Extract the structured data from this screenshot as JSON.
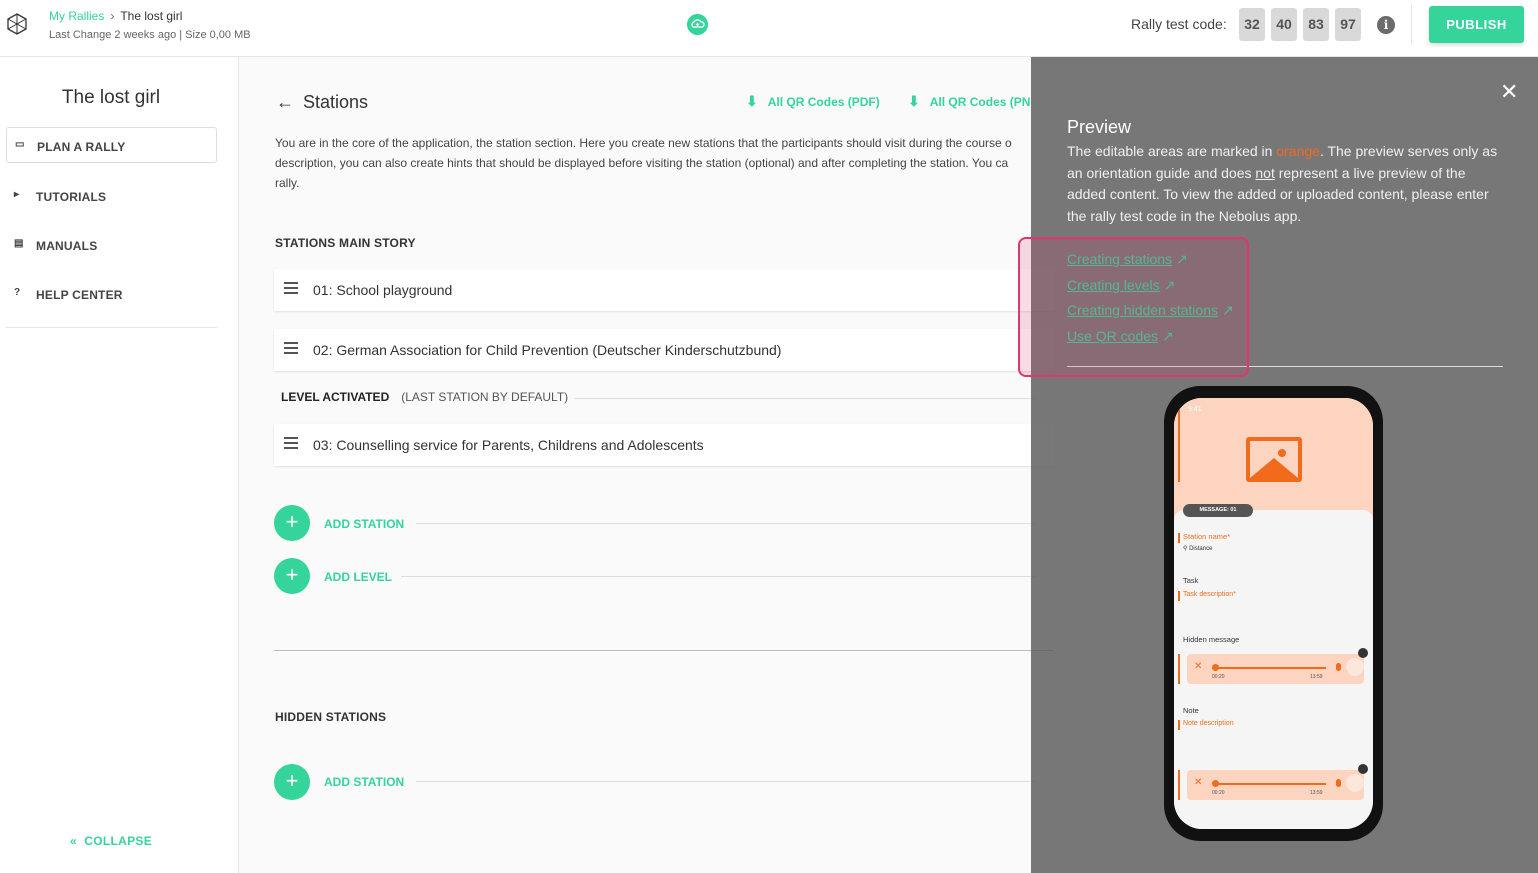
{
  "header": {
    "breadcrumb_parent": "My Rallies",
    "breadcrumb_current": "The lost girl",
    "meta": "Last Change 2 weeks ago | Size 0,00 MB",
    "rally_code_label": "Rally test code:",
    "rally_code": [
      "32",
      "40",
      "83",
      "97"
    ],
    "info_glyph": "i",
    "publish_label": "PUBLISH"
  },
  "sidebar": {
    "title": "The lost girl",
    "items": [
      {
        "label": "PLAN A RALLY",
        "icon": "ticket-icon"
      },
      {
        "label": "TUTORIALS",
        "icon": "play-icon"
      },
      {
        "label": "MANUALS",
        "icon": "document-icon"
      },
      {
        "label": "HELP CENTER",
        "icon": "question-icon"
      }
    ],
    "collapse_label": "COLLAPSE"
  },
  "main": {
    "title": "Stations",
    "download_pdf": "All QR Codes (PDF)",
    "download_png": "All QR Codes (PN",
    "intro_line1": "You are in the core of the application, the station section. Here you create new stations that the participants should visit during the course o",
    "intro_line2": "description, you can also create hints that should be displayed before visiting the station (optional) and after completing the station. You ca",
    "intro_line3": "rally.",
    "main_story_heading": "STATIONS MAIN STORY",
    "stations": [
      "01: School playground",
      "02: German Association for Child Prevention (Deutscher Kinderschutzbund)",
      "03: Counselling service for Parents, Childrens and Adolescents"
    ],
    "level_label": "LEVEL ACTIVATED",
    "level_note": "(LAST STATION BY DEFAULT)",
    "add_station": "ADD STATION",
    "add_level": "ADD LEVEL",
    "hidden_heading": "HIDDEN STATIONS",
    "add_hidden_station": "ADD STATION"
  },
  "preview": {
    "title": "Preview",
    "text_before_orange": "The editable areas are marked in ",
    "orange_word": "orange",
    "text_after_orange": ". The preview serves only as an orientation guide and does ",
    "not_word": "not",
    "text_end": " represent a live preview of the added content. To view the added or uploaded content, please enter the rally test code in the Nebolus app.",
    "links": [
      "Creating stations",
      "Creating levels",
      "Creating hidden stations",
      "Use QR codes"
    ]
  },
  "phone": {
    "time": "9:41",
    "message_pill": "MESSAGE: 01",
    "station_name": "Station name*",
    "distance": "Distance",
    "task": "Task",
    "task_description": "Task description*",
    "hidden_message": "Hidden message",
    "time_start": "00:20",
    "time_end": "13:59",
    "note": "Note",
    "note_description": "Note description"
  },
  "colors": {
    "accent": "#35d49a",
    "orange": "#f26b1d",
    "highlight": "#e0356e"
  }
}
